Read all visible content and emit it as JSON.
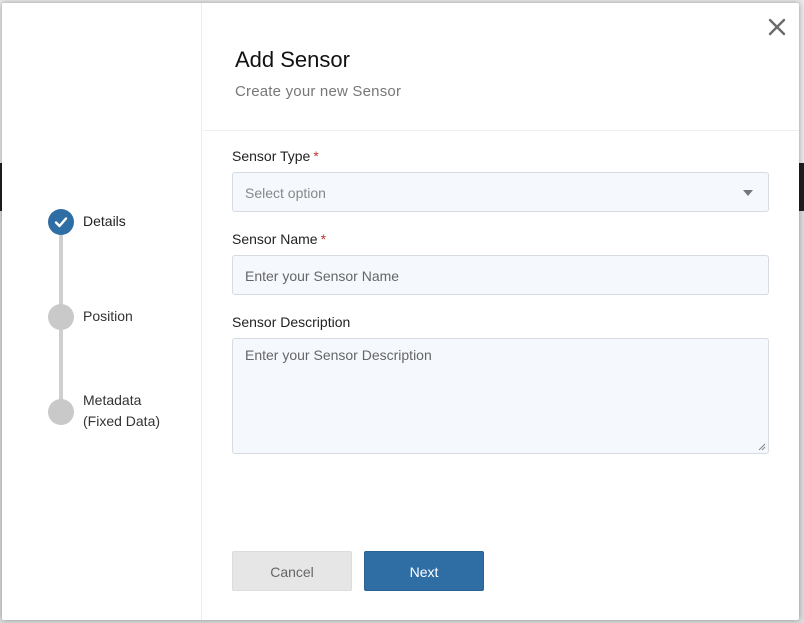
{
  "dialog": {
    "title": "Add Sensor",
    "subtitle": "Create your new Sensor",
    "close_icon": "close-icon"
  },
  "stepper": {
    "steps": [
      {
        "label": "Details",
        "status": "complete",
        "icon": "check-icon"
      },
      {
        "label": "Position",
        "status": "pending"
      },
      {
        "label_line1": "Metadata",
        "label_line2": "(Fixed Data)",
        "status": "pending"
      }
    ]
  },
  "form": {
    "sensor_type": {
      "label": "Sensor Type",
      "required_mark": "*",
      "placeholder": "Select option",
      "icon": "chevron-down-icon"
    },
    "sensor_name": {
      "label": "Sensor Name",
      "required_mark": "*",
      "placeholder": "Enter your Sensor Name"
    },
    "sensor_description": {
      "label": "Sensor Description",
      "placeholder": "Enter your Sensor Description"
    }
  },
  "buttons": {
    "cancel": "Cancel",
    "next": "Next"
  },
  "colors": {
    "primary": "#2f6ea5",
    "required": "#c0392b",
    "step_inactive": "#c9c9c9"
  }
}
